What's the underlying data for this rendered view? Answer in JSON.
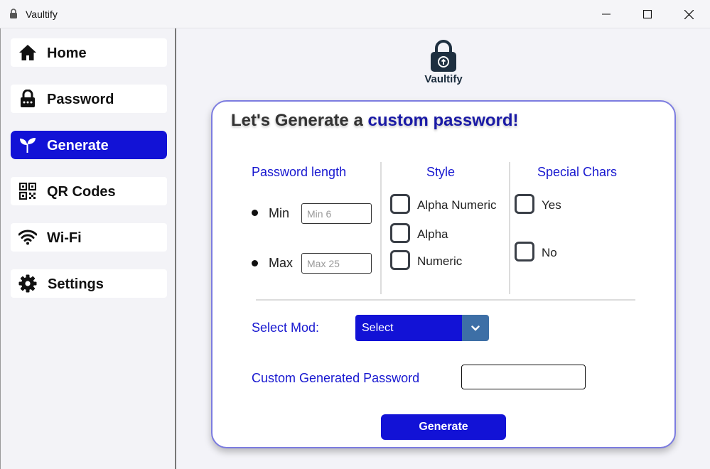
{
  "window": {
    "title": "Vaultify"
  },
  "sidebar": {
    "items": [
      {
        "label": "Home",
        "icon": "home-icon"
      },
      {
        "label": "Password",
        "icon": "lock-icon"
      },
      {
        "label": "Generate",
        "icon": "sprout-icon",
        "active": true
      },
      {
        "label": "QR Codes",
        "icon": "qr-code-icon"
      },
      {
        "label": "Wi-Fi",
        "icon": "wifi-icon"
      },
      {
        "label": "Settings",
        "icon": "gear-icon"
      }
    ]
  },
  "brand": {
    "name": "Vaultify",
    "logo_icon": "padlock-logo-icon"
  },
  "card": {
    "title_prefix": "Let's Generate a ",
    "title_accent": "custom password!",
    "length": {
      "heading": "Password length",
      "min_label": "Min",
      "min_placeholder": "Min 6",
      "max_label": "Max",
      "max_placeholder": "Max 25"
    },
    "style": {
      "heading": "Style",
      "options": [
        "Alpha Numeric",
        "Alpha",
        "Numeric"
      ]
    },
    "special": {
      "heading": "Special Chars",
      "options": [
        "Yes",
        "No"
      ]
    },
    "mode": {
      "label": "Select Mod:",
      "selected": "Select"
    },
    "output": {
      "label": "Custom Generated Password",
      "value": ""
    },
    "generate_label": "Generate"
  },
  "colors": {
    "accent": "#1212d6",
    "heading_blue": "#1818d0",
    "title_accent": "#1a1aa6",
    "card_border": "#7c7ce0",
    "select_arrow_bg": "#3d6fa6"
  }
}
